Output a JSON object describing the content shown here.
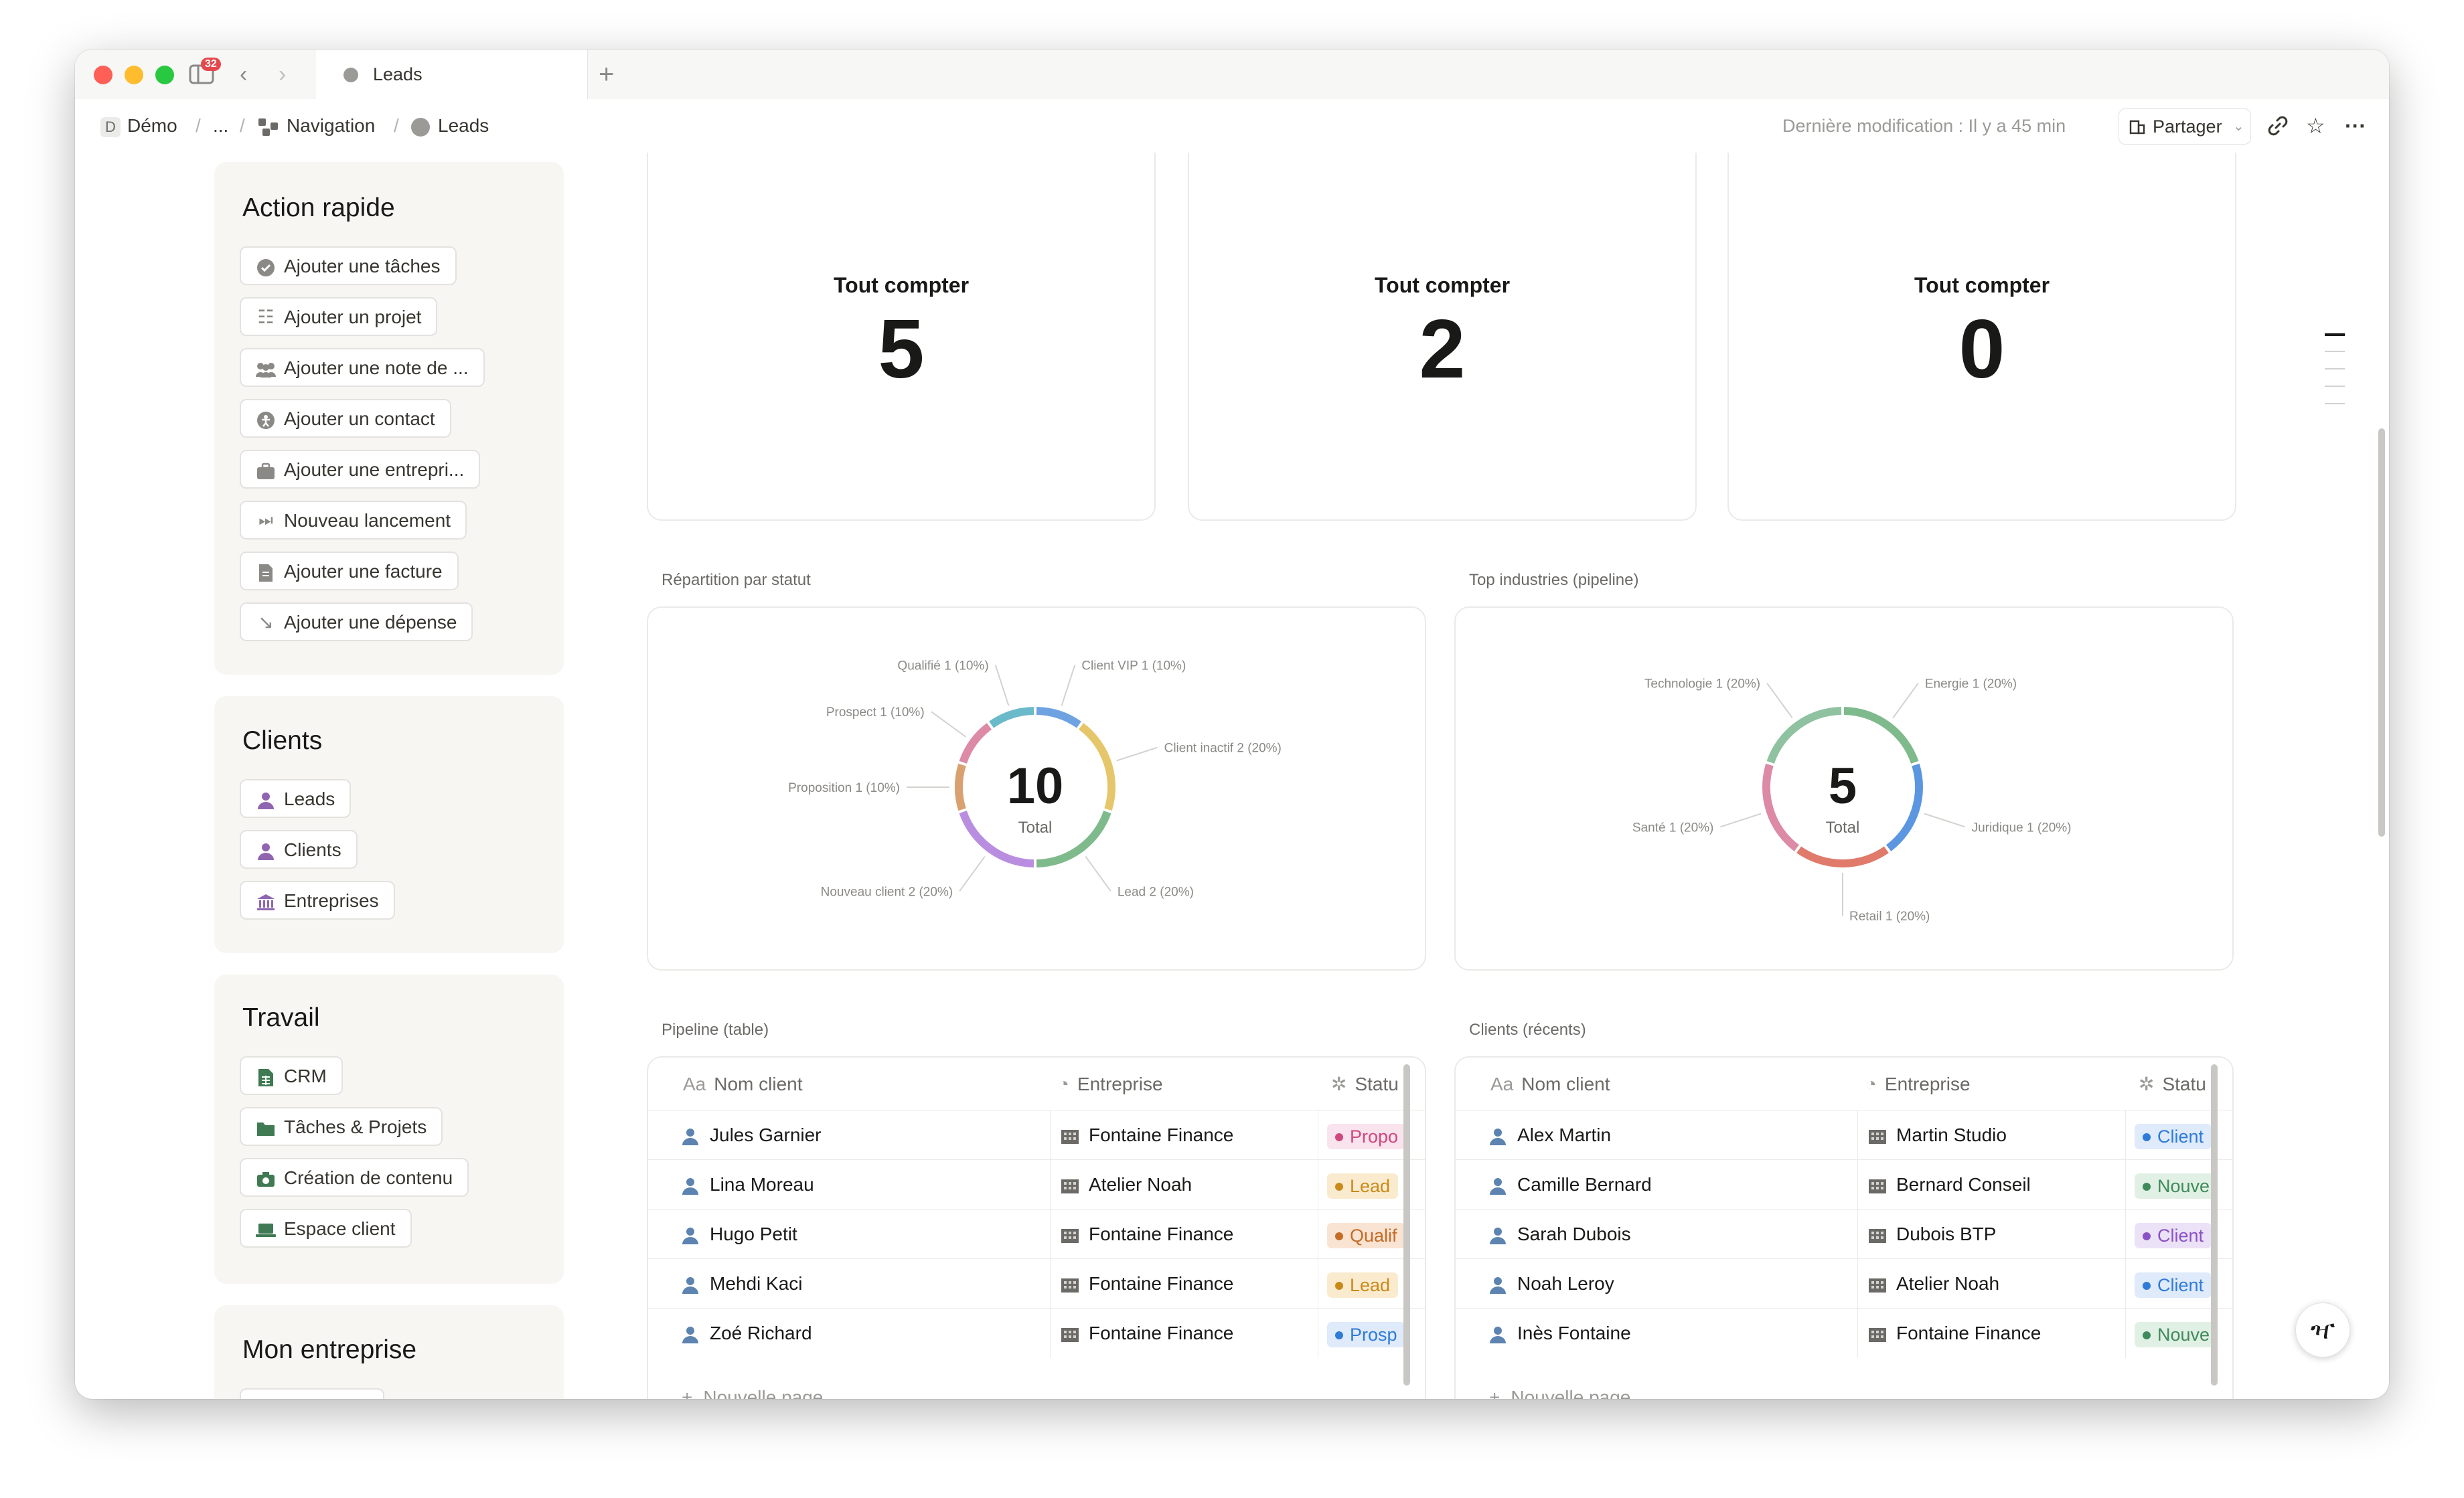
{
  "window": {
    "tab_title": "Leads",
    "notification_count": "32"
  },
  "breadcrumb": {
    "workspace_initial": "D",
    "workspace": "Démo",
    "ellipsis": "...",
    "navigation": "Navigation",
    "current": "Leads"
  },
  "header": {
    "last_modified": "Dernière modification : Il y a 45 min",
    "share_label": "Partager"
  },
  "quick_actions": {
    "title": "Action rapide",
    "items": [
      {
        "label": "Ajouter une tâches",
        "icon": "check-circle-icon"
      },
      {
        "label": "Ajouter un projet",
        "icon": "checklist-icon"
      },
      {
        "label": "Ajouter une note de ...",
        "icon": "people-icon"
      },
      {
        "label": "Ajouter un contact",
        "icon": "person-circle-icon"
      },
      {
        "label": "Ajouter une entrepri...",
        "icon": "briefcase-icon"
      },
      {
        "label": "Nouveau lancement",
        "icon": "fast-forward-icon"
      },
      {
        "label": "Ajouter une facture",
        "icon": "document-icon"
      },
      {
        "label": "Ajouter une dépense",
        "icon": "arrow-down-right-icon"
      }
    ]
  },
  "clients_nav": {
    "title": "Clients",
    "items": [
      {
        "label": "Leads",
        "icon": "person-icon"
      },
      {
        "label": "Clients",
        "icon": "person-icon"
      },
      {
        "label": "Entreprises",
        "icon": "bank-icon"
      }
    ]
  },
  "work_nav": {
    "title": "Travail",
    "items": [
      {
        "label": "CRM",
        "icon": "spreadsheet-icon"
      },
      {
        "label": "Tâches & Projets",
        "icon": "folder-icon"
      },
      {
        "label": "Création de contenu",
        "icon": "camera-icon"
      },
      {
        "label": "Espace client",
        "icon": "laptop-icon"
      }
    ]
  },
  "company_nav": {
    "title": "Mon entreprise"
  },
  "stat_cards": [
    {
      "label": "Tout compter",
      "value": "5"
    },
    {
      "label": "Tout compter",
      "value": "2"
    },
    {
      "label": "Tout compter",
      "value": "0"
    }
  ],
  "sections": {
    "status_chart": "Répartition par statut",
    "industry_chart": "Top industries (pipeline)",
    "pipeline_table": "Pipeline (table)",
    "clients_table": "Clients (récents)"
  },
  "chart_data": [
    {
      "type": "pie",
      "title": "Répartition par statut",
      "center_value": "10",
      "center_label": "Total",
      "slices": [
        {
          "label": "Client VIP",
          "value": 1,
          "percent": "1 (10%)",
          "color": "#6fa2e0"
        },
        {
          "label": "Client inactif",
          "value": 2,
          "percent": "2 (20%)",
          "color": "#e6c66a"
        },
        {
          "label": "Lead",
          "value": 2,
          "percent": "2 (20%)",
          "color": "#7fba8c"
        },
        {
          "label": "Nouveau client",
          "value": 2,
          "percent": "2 (20%)",
          "color": "#b98ee0"
        },
        {
          "label": "Proposition",
          "value": 1,
          "percent": "1 (10%)",
          "color": "#d9a070"
        },
        {
          "label": "Prospect",
          "value": 1,
          "percent": "1 (10%)",
          "color": "#dc8aa6"
        },
        {
          "label": "Qualifié",
          "value": 1,
          "percent": "1 (10%)",
          "color": "#6bbac9"
        }
      ]
    },
    {
      "type": "pie",
      "title": "Top industries (pipeline)",
      "center_value": "5",
      "center_label": "Total",
      "slices": [
        {
          "label": "Energie",
          "value": 1,
          "percent": "1 (20%)",
          "color": "#7fba8c"
        },
        {
          "label": "Juridique",
          "value": 1,
          "percent": "1 (20%)",
          "color": "#5b96e0"
        },
        {
          "label": "Retail",
          "value": 1,
          "percent": "1 (20%)",
          "color": "#e07a6a"
        },
        {
          "label": "Santé",
          "value": 1,
          "percent": "1 (20%)",
          "color": "#dc8aa6"
        },
        {
          "label": "Technologie",
          "value": 1,
          "percent": "1 (20%)",
          "color": "#8fc2a0"
        }
      ]
    }
  ],
  "pipeline_table": {
    "columns": [
      "Nom client",
      "Entreprise",
      "Statu"
    ],
    "rows": [
      {
        "name": "Jules Garnier",
        "company": "Fontaine Finance",
        "status": "Propo",
        "status_color": "#d0487e",
        "status_bg": "#f9e3ec"
      },
      {
        "name": "Lina Moreau",
        "company": "Atelier Noah",
        "status": "Lead",
        "status_color": "#c98a1a",
        "status_bg": "#faebcf"
      },
      {
        "name": "Hugo Petit",
        "company": "Fontaine Finance",
        "status": "Qualif",
        "status_color": "#c46b26",
        "status_bg": "#f9e4d3"
      },
      {
        "name": "Mehdi Kaci",
        "company": "Fontaine Finance",
        "status": "Lead",
        "status_color": "#c98a1a",
        "status_bg": "#faebcf"
      },
      {
        "name": "Zoé Richard",
        "company": "Fontaine Finance",
        "status": "Prosp",
        "status_color": "#2f7bd8",
        "status_bg": "#dfeafa"
      }
    ],
    "new_page": "Nouvelle page"
  },
  "clients_table": {
    "columns": [
      "Nom client",
      "Entreprise",
      "Statu"
    ],
    "rows": [
      {
        "name": "Alex Martin",
        "company": "Martin Studio",
        "status": "Client",
        "status_color": "#2f7bd8",
        "status_bg": "#dfeafa"
      },
      {
        "name": "Camille Bernard",
        "company": "Bernard Conseil",
        "status": "Nouve",
        "status_color": "#3f8a5a",
        "status_bg": "#e1f0e5"
      },
      {
        "name": "Sarah Dubois",
        "company": "Dubois BTP",
        "status": "Client",
        "status_color": "#8a52c4",
        "status_bg": "#ece2f7"
      },
      {
        "name": "Noah Leroy",
        "company": "Atelier Noah",
        "status": "Client",
        "status_color": "#2f7bd8",
        "status_bg": "#dfeafa"
      },
      {
        "name": "Inès Fontaine",
        "company": "Fontaine Finance",
        "status": "Nouve",
        "status_color": "#3f8a5a",
        "status_bg": "#e1f0e5"
      }
    ],
    "new_page": "Nouvelle page"
  }
}
